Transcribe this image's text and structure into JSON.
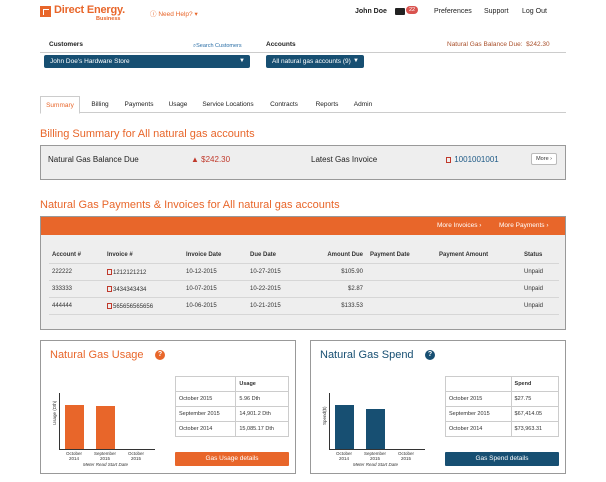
{
  "header": {
    "brand": "Direct Energy.",
    "brand_sub": "Business",
    "need_help": "Need Help? ▾",
    "user_name": "John Doe",
    "message_count": "22",
    "links": [
      "Preferences",
      "Support",
      "Log Out"
    ]
  },
  "selectors": {
    "customers_label": "Customers",
    "search_customers": "Search Customers",
    "customer_value": "John Doe's Hardware Store",
    "accounts_label": "Accounts",
    "accounts_value": "All natural gas accounts (9)",
    "balance_label": "Natural Gas Balance Due:",
    "balance_value": "$242.30"
  },
  "tabs": [
    "Summary",
    "Billing",
    "Payments",
    "Usage",
    "Service Locations",
    "Contracts",
    "Reports",
    "Admin"
  ],
  "billing_summary": {
    "title": "Billing Summary for All natural gas accounts",
    "balance_label": "Natural Gas Balance Due",
    "balance_value": "$242.30",
    "latest_label": "Latest Gas Invoice",
    "latest_value": "1001001001",
    "more_label": "More"
  },
  "payments": {
    "title": "Natural Gas Payments & Invoices for All natural gas accounts",
    "more_invoices": "More Invoices",
    "more_payments": "More Payments",
    "headers": [
      "Account #",
      "Invoice #",
      "Invoice Date",
      "Due Date",
      "Amount Due",
      "Payment Date",
      "Payment Amount",
      "Status"
    ],
    "rows": [
      {
        "account": "222222",
        "invoice": "1212121212",
        "invoice_date": "10-12-2015",
        "due_date": "10-27-2015",
        "amount": "$105.90",
        "payment_date": "",
        "payment_amount": "",
        "status": "Unpaid"
      },
      {
        "account": "333333",
        "invoice": "3434343434",
        "invoice_date": "10-07-2015",
        "due_date": "10-22-2015",
        "amount": "$2.87",
        "payment_date": "",
        "payment_amount": "",
        "status": "Unpaid"
      },
      {
        "account": "444444",
        "invoice": "565656565656",
        "invoice_date": "10-06-2015",
        "due_date": "10-21-2015",
        "amount": "$133.53",
        "payment_date": "",
        "payment_amount": "",
        "status": "Unpaid"
      }
    ]
  },
  "usage_panel": {
    "title": "Natural Gas Usage",
    "col_header": "Usage",
    "rows": [
      {
        "month": "October 2015",
        "value": "5.96 Dth"
      },
      {
        "month": "September 2015",
        "value": "14,901.2 Dth"
      },
      {
        "month": "October 2014",
        "value": "15,085.17 Dth"
      }
    ],
    "button": "Gas Usage details",
    "color": "#e8662a"
  },
  "spend_panel": {
    "title": "Natural Gas Spend",
    "col_header": "Spend",
    "rows": [
      {
        "month": "October 2015",
        "value": "$27.75"
      },
      {
        "month": "September 2015",
        "value": "$67,414.05"
      },
      {
        "month": "October 2014",
        "value": "$73,963.31"
      }
    ],
    "button": "Gas Spend details",
    "color": "#174f72"
  },
  "chart_data": [
    {
      "type": "bar",
      "ylabel": "Usage (Dth)",
      "xlabel": "Meter Read Start Date",
      "categories": [
        "October 2014",
        "September 2015",
        "October 2015"
      ],
      "values": [
        15085.17,
        14901.2,
        5.96
      ],
      "color": "#e8662a"
    },
    {
      "type": "bar",
      "ylabel": "Spend($)",
      "xlabel": "Meter Read Start Date",
      "categories": [
        "October 2014",
        "September 2015",
        "October 2015"
      ],
      "values": [
        73963.31,
        67414.05,
        27.75
      ],
      "color": "#174f72"
    }
  ]
}
